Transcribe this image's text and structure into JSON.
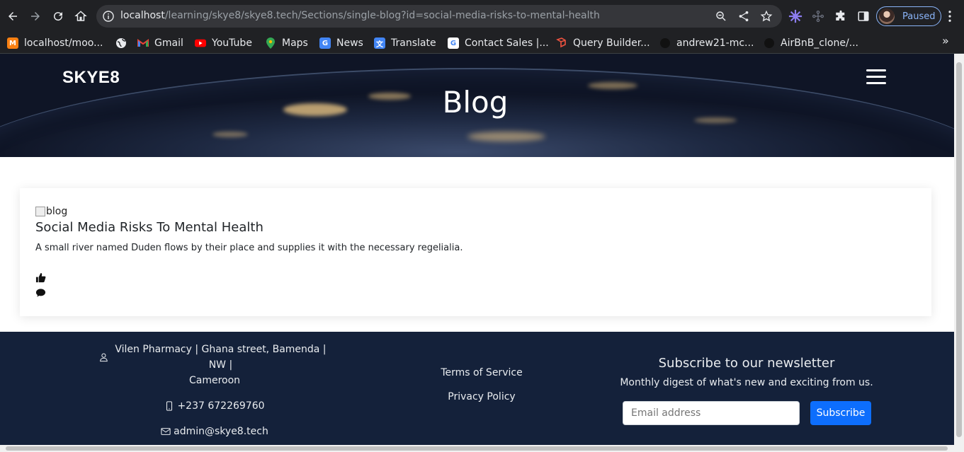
{
  "browser": {
    "url_host": "localhost",
    "url_path": "/learning/skye8/skye8.tech/Sections/single-blog?id=social-media-risks-to-mental-health",
    "profile_status": "Paused",
    "bookmarks": [
      {
        "label": "localhost/moo...",
        "icon": "moodle-icon"
      },
      {
        "label": "",
        "icon": "globe-icon"
      },
      {
        "label": "Gmail",
        "icon": "gmail-icon"
      },
      {
        "label": "YouTube",
        "icon": "youtube-icon"
      },
      {
        "label": "Maps",
        "icon": "maps-icon"
      },
      {
        "label": "News",
        "icon": "news-icon"
      },
      {
        "label": "Translate",
        "icon": "translate-icon"
      },
      {
        "label": "Contact Sales |...",
        "icon": "google-icon"
      },
      {
        "label": "Query Builder...",
        "icon": "laravel-icon"
      },
      {
        "label": "andrew21-mc...",
        "icon": "github-icon"
      },
      {
        "label": "AirBnB_clone/...",
        "icon": "github-icon"
      }
    ],
    "more_bookmarks": "»"
  },
  "site": {
    "brand": "SKYE8",
    "hero_title": "Blog"
  },
  "post": {
    "image_alt": "blog",
    "title": "Social Media Risks To Mental Health",
    "description": "A small river named Duden flows by their place and supplies it with the necessary regelialia."
  },
  "footer": {
    "address_line1": "Vilen Pharmacy | Ghana street, Bamenda | NW |",
    "address_line2": "Cameroon",
    "phone": "+237 672269760",
    "email": "admin@skye8.tech",
    "links": [
      "Terms of Service",
      "Privacy Policy"
    ],
    "newsletter_title": "Subscribe to our newsletter",
    "newsletter_sub": "Monthly digest of what's new and exciting from us.",
    "email_placeholder": "Email address",
    "subscribe_label": "Subscribe"
  },
  "colors": {
    "footer_bg": "#14213a",
    "subscribe_blue": "#0d6efd",
    "browser_bg": "#202124"
  }
}
